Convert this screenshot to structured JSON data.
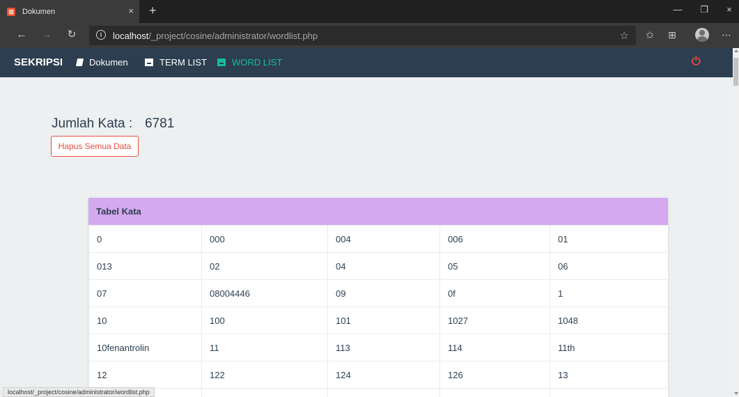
{
  "browser": {
    "tab_title": "Dokumen",
    "tab_favicon": "xampp-icon",
    "tab_close": "×",
    "new_tab": "+",
    "window_controls": {
      "minimize": "—",
      "restore": "❐",
      "close": "×"
    },
    "nav": {
      "back": "←",
      "forward": "→",
      "refresh": "↻"
    },
    "url_host": "localhost",
    "url_path": "/_project/cosine/administrator/wordlist.php",
    "favorite": "☆",
    "status_url": "localhost/_project/cosine/administrator/wordlist.php"
  },
  "navbar": {
    "brand": "SEKRIPSI",
    "items": [
      {
        "label": "Dokumen",
        "icon": "book-icon",
        "active": false
      },
      {
        "label": "TERM LIST",
        "icon": "archive-icon",
        "active": false
      },
      {
        "label": "WORD LIST",
        "icon": "archive-icon",
        "active": true
      }
    ],
    "power_icon": "⏻"
  },
  "summary": {
    "label": "Jumlah Kata :",
    "count": "6781",
    "delete_button": "Hapus Semua Data"
  },
  "table": {
    "title": "Tabel Kata",
    "rows": [
      [
        "0",
        "000",
        "004",
        "006",
        "01"
      ],
      [
        "013",
        "02",
        "04",
        "05",
        "06"
      ],
      [
        "07",
        "08004446",
        "09",
        "0f",
        "1"
      ],
      [
        "10",
        "100",
        "101",
        "1027",
        "1048"
      ],
      [
        "10fenantrolin",
        "11",
        "113",
        "114",
        "11th"
      ],
      [
        "12",
        "122",
        "124",
        "126",
        "13"
      ],
      [
        "",
        "",
        "",
        "",
        ""
      ]
    ]
  },
  "colors": {
    "navbar_bg": "#2c3e50",
    "active_nav": "#18bc9c",
    "danger": "#e74c3c",
    "panel_header": "#d4a9ef"
  }
}
